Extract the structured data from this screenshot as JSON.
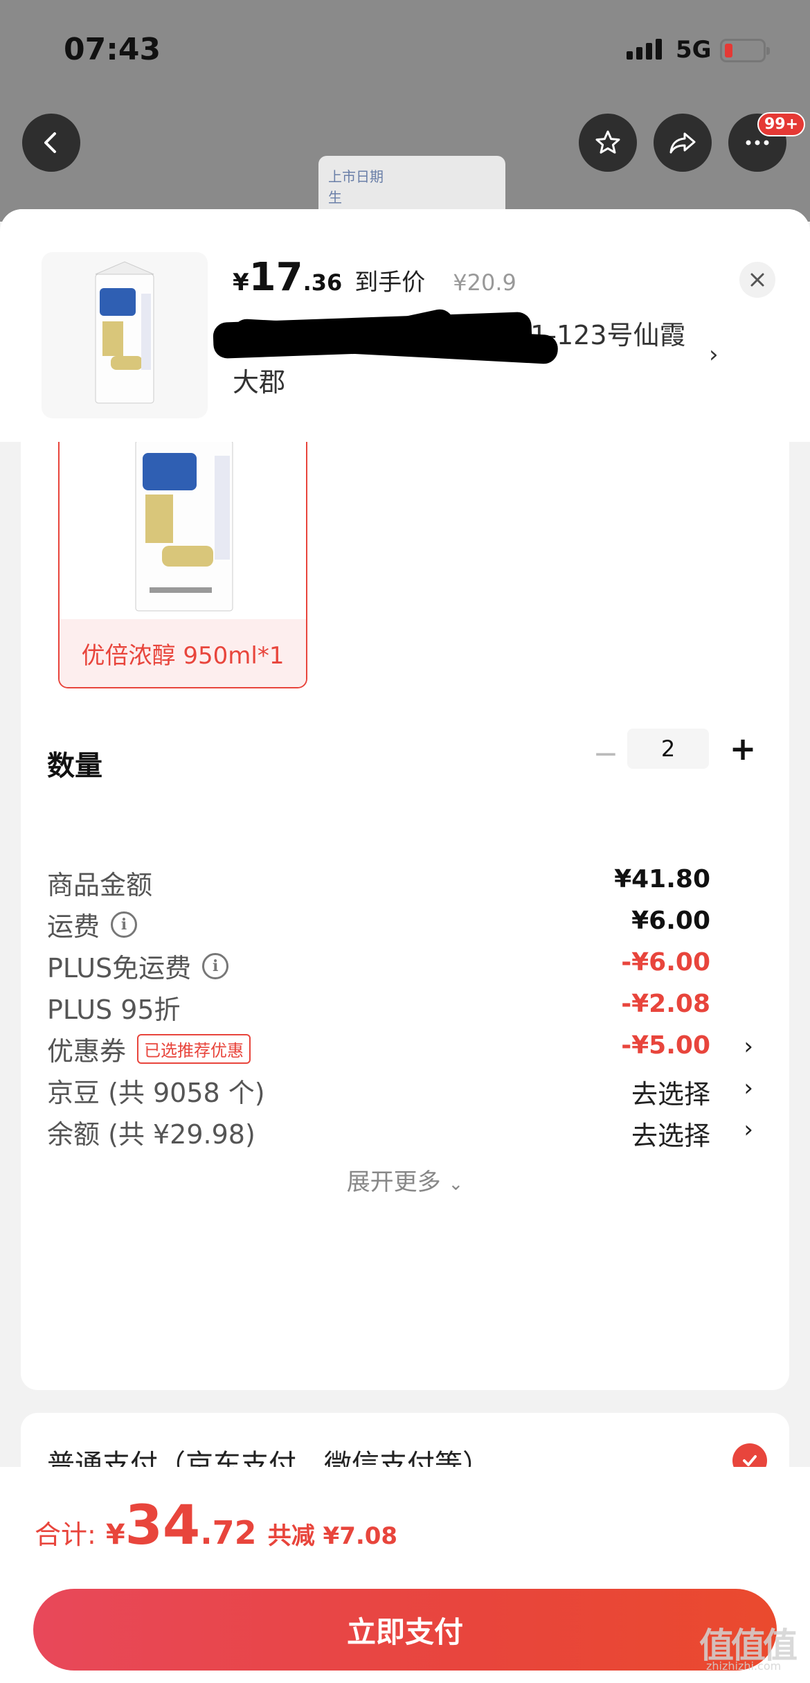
{
  "status_bar": {
    "time": "07:43",
    "network": "5G"
  },
  "background_product": {
    "label_line1": "上市日期",
    "label_line2": "生"
  },
  "top_nav": {
    "badge": "99+"
  },
  "product_header": {
    "price_symbol": "¥",
    "price_integer": "17",
    "price_decimal": ".36",
    "price_tag": "到手价",
    "original_price": "¥20.9",
    "address_line1": "天 1-123号仙霞",
    "address_line2": "大郡"
  },
  "spec": {
    "option_label": "优倍浓醇 950ml*1",
    "quantity_label": "数量",
    "quantity_value": "2",
    "minus": "−",
    "plus": "+"
  },
  "price_detail": {
    "rows": [
      {
        "label": "商品金额",
        "value": "¥41.80"
      },
      {
        "label": "运费",
        "value": "¥6.00"
      },
      {
        "label": "PLUS免运费",
        "value": "-¥6.00"
      },
      {
        "label": "PLUS 95折",
        "value": "-¥2.08"
      },
      {
        "label": "优惠券",
        "tag": "已选推荐优惠",
        "value": "-¥5.00"
      },
      {
        "label": "京豆 (共 9058 个)",
        "value": "去选择"
      },
      {
        "label": "余额 (共 ¥29.98)",
        "value": "去选择"
      }
    ],
    "expand_label": "展开更多"
  },
  "payment": {
    "method_label": "普通支付（京东支付、微信支付等）"
  },
  "bottom": {
    "total_label": "合计:",
    "total_symbol": "¥",
    "total_integer": "34",
    "total_decimal": ".72",
    "saving": "共减 ¥7.08",
    "pay_button": "立即支付"
  },
  "watermark": {
    "text": "值值值",
    "sub": "zhizhizhi.com"
  },
  "colors": {
    "accent": "#e8453c",
    "sheet_bg": "#f2f2f2",
    "dim_bg": "#8a8a8a"
  }
}
